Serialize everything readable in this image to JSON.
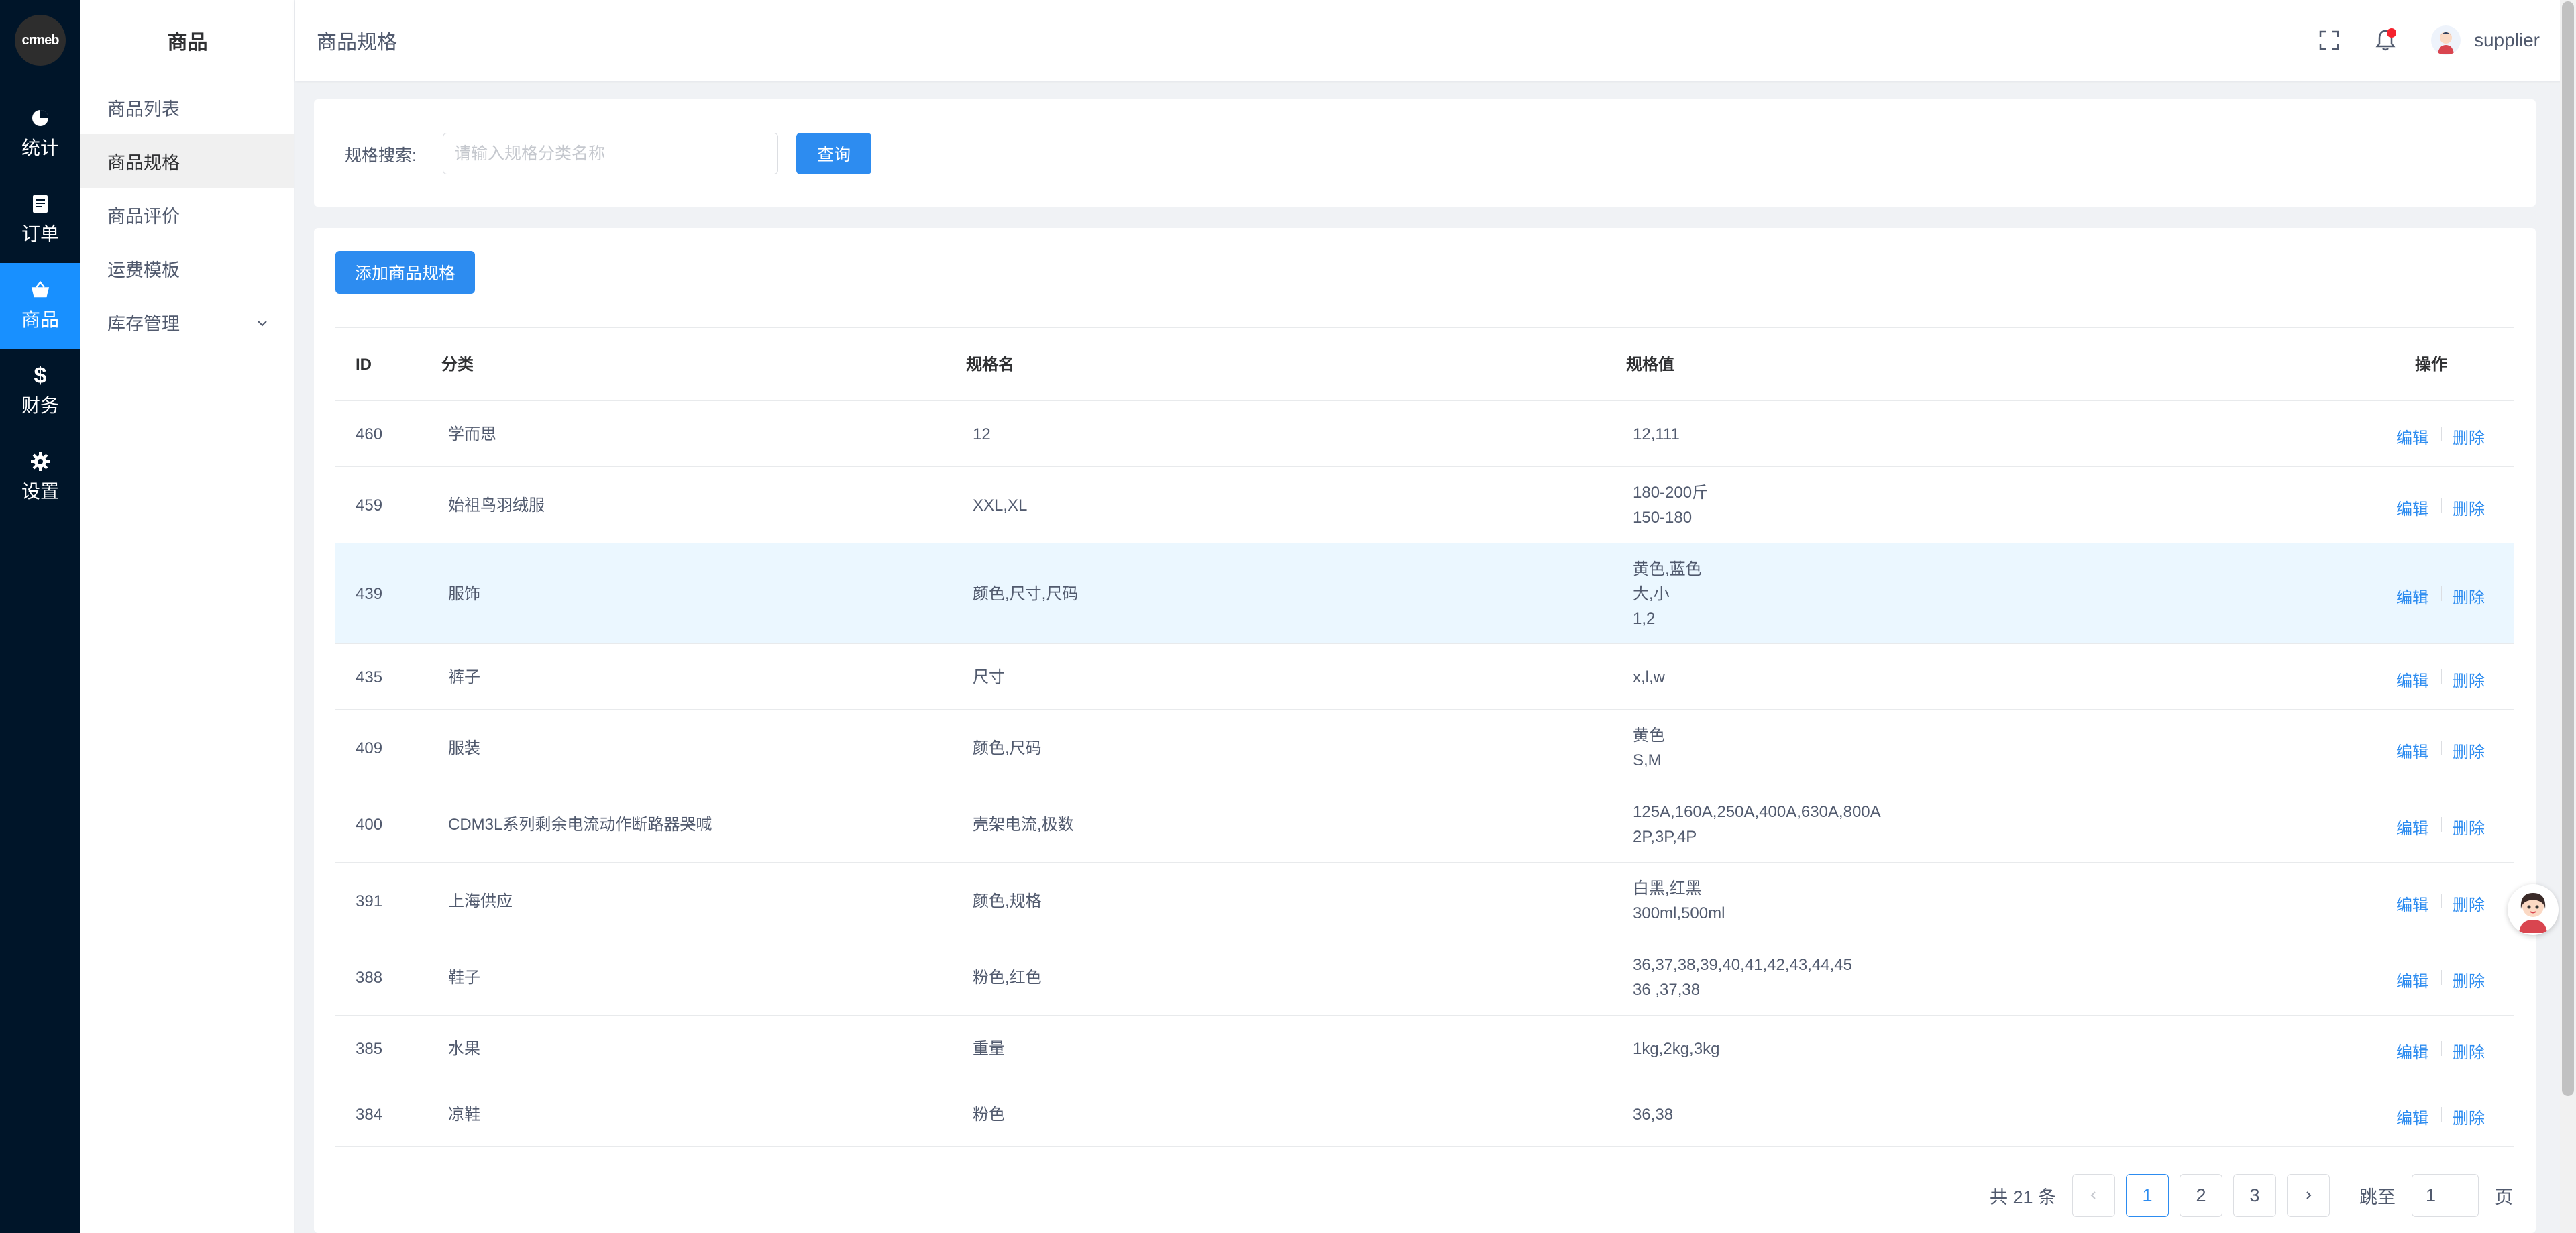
{
  "logo_text": "crmeb",
  "rail": [
    {
      "label": "统计",
      "icon": "pie-chart-icon"
    },
    {
      "label": "订单",
      "icon": "document-icon"
    },
    {
      "label": "商品",
      "icon": "basket-icon"
    },
    {
      "label": "财务",
      "icon": "dollar-icon"
    },
    {
      "label": "设置",
      "icon": "gear-icon"
    }
  ],
  "submenu": {
    "title": "商品",
    "items": [
      {
        "label": "商品列表"
      },
      {
        "label": "商品规格"
      },
      {
        "label": "商品评价"
      },
      {
        "label": "运费模板"
      },
      {
        "label": "库存管理"
      }
    ]
  },
  "header": {
    "page_title": "商品规格",
    "username": "supplier",
    "icons": [
      "fullscreen-icon",
      "bell-icon"
    ]
  },
  "search": {
    "label": "规格搜索:",
    "placeholder": "请输入规格分类名称",
    "value": "",
    "button": "查询"
  },
  "add_button": "添加商品规格",
  "table": {
    "columns": {
      "id": "ID",
      "category": "分类",
      "name": "规格名",
      "value": "规格值",
      "ops": "操作"
    },
    "edit_label": "编辑",
    "delete_label": "删除",
    "rows": [
      {
        "id": "460",
        "category": "学而思",
        "name": "12",
        "values": [
          "12,111"
        ]
      },
      {
        "id": "459",
        "category": "始祖鸟羽绒服",
        "name": "XXL,XL",
        "values": [
          "180-200斤",
          "150-180"
        ]
      },
      {
        "id": "439",
        "category": "服饰",
        "name": "颜色,尺寸,尺码",
        "values": [
          "黄色,蓝色",
          "大,小",
          "1,2"
        ]
      },
      {
        "id": "435",
        "category": "裤子",
        "name": "尺寸",
        "values": [
          "x,l,w"
        ]
      },
      {
        "id": "409",
        "category": "服装",
        "name": "颜色,尺码",
        "values": [
          "黄色",
          "S,M"
        ]
      },
      {
        "id": "400",
        "category": "CDM3L系列剩余电流动作断路器哭喊",
        "name": "壳架电流,极数",
        "values": [
          "125A,160A,250A,400A,630A,800A",
          "2P,3P,4P"
        ]
      },
      {
        "id": "391",
        "category": "上海供应",
        "name": "颜色,规格",
        "values": [
          "白黑,红黑",
          "300ml,500ml"
        ]
      },
      {
        "id": "388",
        "category": "鞋子",
        "name": "粉色,红色",
        "values": [
          "36,37,38,39,40,41,42,43,44,45",
          "36 ,37,38"
        ]
      },
      {
        "id": "385",
        "category": "水果",
        "name": "重量",
        "values": [
          "1kg,2kg,3kg"
        ]
      },
      {
        "id": "384",
        "category": "凉鞋",
        "name": "粉色",
        "values": [
          "36,38"
        ]
      }
    ]
  },
  "pagination": {
    "total_text": "共 21 条",
    "pages": [
      "1",
      "2",
      "3"
    ],
    "current": "1",
    "jump_label": "跳至",
    "jump_value": "1",
    "page_suffix": "页",
    "prev_icon": "chevron-left-icon",
    "next_icon": "chevron-right-icon"
  },
  "colors": {
    "primary": "#2d8cf0",
    "rail_bg": "#001529",
    "rail_active": "#1890ff",
    "highlight_row": "#ebf7ff"
  }
}
